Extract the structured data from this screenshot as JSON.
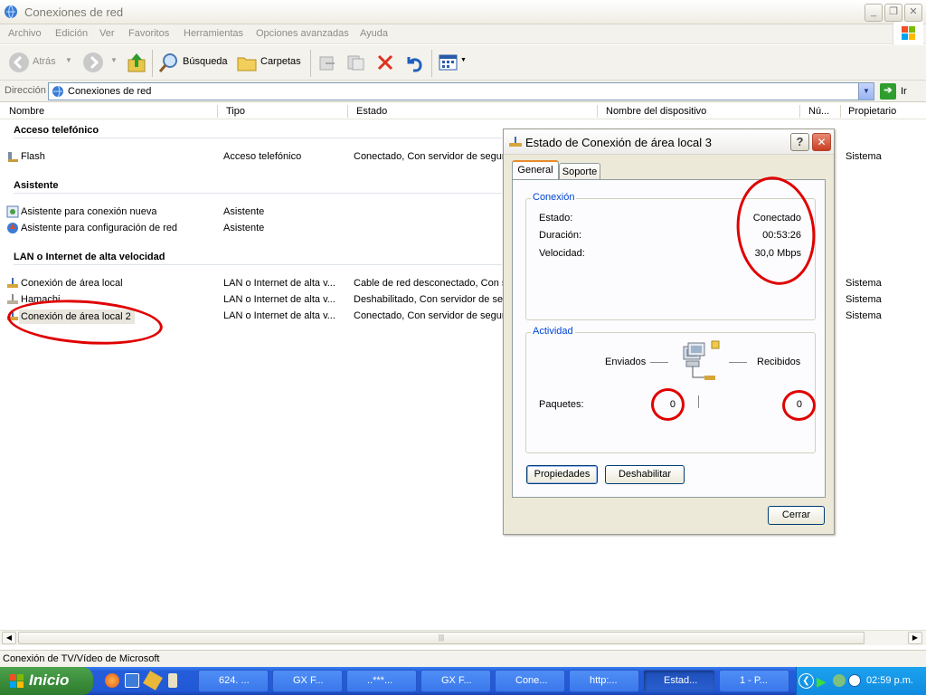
{
  "window": {
    "title": "Conexiones de red"
  },
  "menu": [
    "Archivo",
    "Edición",
    "Ver",
    "Favoritos",
    "Herramientas",
    "Opciones avanzadas",
    "Ayuda"
  ],
  "toolbar": {
    "back": "Atrás",
    "search": "Búsqueda",
    "folders": "Carpetas"
  },
  "address": {
    "label": "Dirección",
    "value": "Conexiones de red",
    "go": "Ir"
  },
  "columns": [
    "Nombre",
    "Tipo",
    "Estado",
    "Nombre del dispositivo",
    "Nú...",
    "Propietario"
  ],
  "groups": [
    {
      "title": "Acceso telefónico",
      "items": [
        {
          "name": "Flash",
          "type": "Acceso telefónico",
          "status": "Conectado, Con servidor de segur",
          "owner": "Sistema"
        }
      ]
    },
    {
      "title": "Asistente",
      "items": [
        {
          "name": "Asistente para conexión nueva",
          "type": "Asistente",
          "status": "",
          "owner": ""
        },
        {
          "name": "Asistente para configuración de red",
          "type": "Asistente",
          "status": "",
          "owner": ""
        }
      ]
    },
    {
      "title": "LAN o Internet de alta velocidad",
      "items": [
        {
          "name": "Conexión de área local",
          "type": "LAN o Internet de alta v...",
          "status": "Cable de red desconectado, Con s",
          "owner": "Sistema"
        },
        {
          "name": "Hamachi",
          "type": "LAN o Internet de alta v...",
          "status": "Deshabilitado, Con servidor de seg",
          "owner": "Sistema"
        },
        {
          "name": "Conexión de área local 2",
          "type": "LAN o Internet de alta v...",
          "status": "Conectado, Con servidor de segur",
          "owner": "Sistema"
        }
      ]
    }
  ],
  "statusbar": {
    "text": "Conexión de TV/Vídeo de Microsoft"
  },
  "dialog": {
    "title": "Estado de Conexión de área local 3",
    "tabs": [
      "General",
      "Soporte"
    ],
    "connection": {
      "legend": "Conexión",
      "state_label": "Estado:",
      "state_value": "Conectado",
      "duration_label": "Duración:",
      "duration_value": "00:53:26",
      "speed_label": "Velocidad:",
      "speed_value": "30,0 Mbps"
    },
    "activity": {
      "legend": "Actividad",
      "sent_label": "Enviados",
      "received_label": "Recibidos",
      "packets_label": "Paquetes:",
      "packets_sent": "0",
      "packets_received": "0"
    },
    "buttons": {
      "properties": "Propiedades",
      "disable": "Deshabilitar",
      "close": "Cerrar"
    }
  },
  "taskbar": {
    "start": "Inicio",
    "buttons": [
      "624. ...",
      "GX F...",
      "..***...",
      "GX F...",
      "Cone...",
      "http:...",
      "Estad...",
      "1 - P..."
    ],
    "clock": "02:59 p.m."
  },
  "colors": {
    "title_text": "#7c7a72",
    "legend_blue": "#0046d5",
    "taskbar_blue": "#2158d6",
    "start_green": "#3c8e3c",
    "annotation_red": "#e00000"
  }
}
